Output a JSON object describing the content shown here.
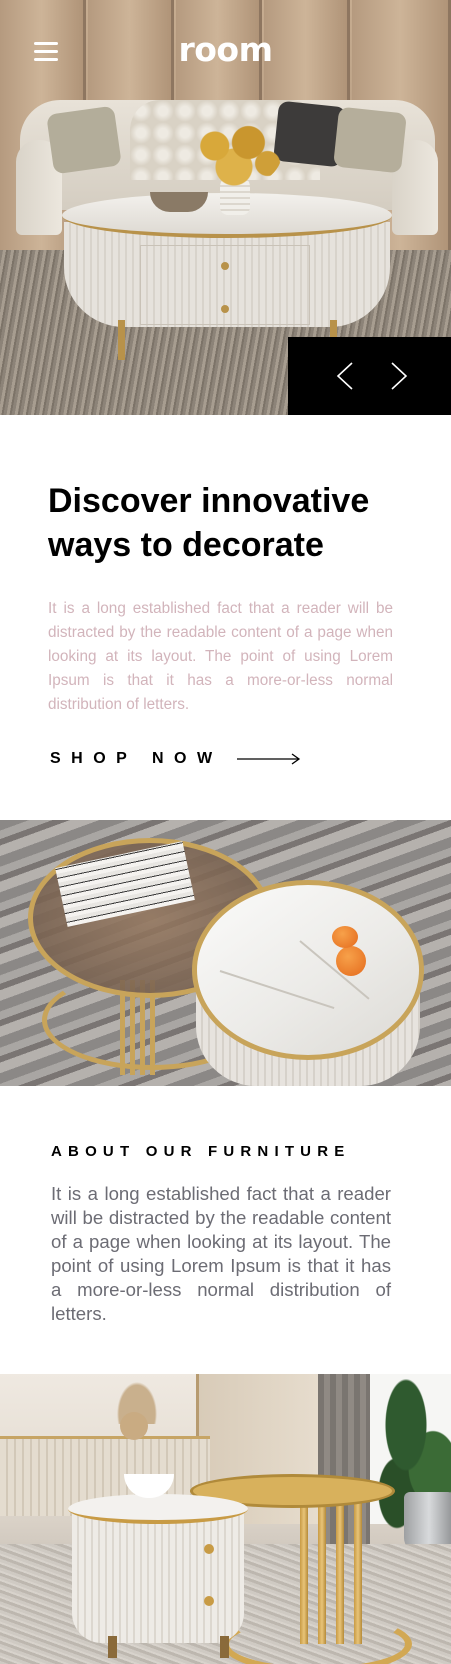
{
  "header": {
    "logo": "room",
    "menu_icon": "hamburger-menu-icon"
  },
  "hero": {
    "image": "living-room-with-oval-coffee-table",
    "prev_icon": "chevron-left-icon",
    "next_icon": "chevron-right-icon",
    "nav_background": "#000000"
  },
  "discover": {
    "title": "Discover innovative ways to decorate",
    "body": "It is a long established fact that a reader will be distracted by the readable content of a page when looking at its layout. The point of using Lorem Ipsum is that it has a more-or-less normal distribution of letters.",
    "body_color": "#d2b4bb",
    "cta_label": "SHOP NOW",
    "cta_icon": "long-arrow-right-icon"
  },
  "about": {
    "image": "nesting-coffee-tables-glass-and-marble",
    "title": "ABOUT OUR FURNITURE",
    "body": "It is a long established fact that a reader will be distracted by the readable content of a page when looking at its layout. The point of using Lorem Ipsum is that it has a more-or-less normal distribution of letters.",
    "body_color": "#6c6c74"
  },
  "bottom": {
    "image": "white-and-gold-nesting-tables-room"
  },
  "colors": {
    "accent_gold": "#c8a45a",
    "text_primary": "#000000",
    "background": "#ffffff"
  }
}
